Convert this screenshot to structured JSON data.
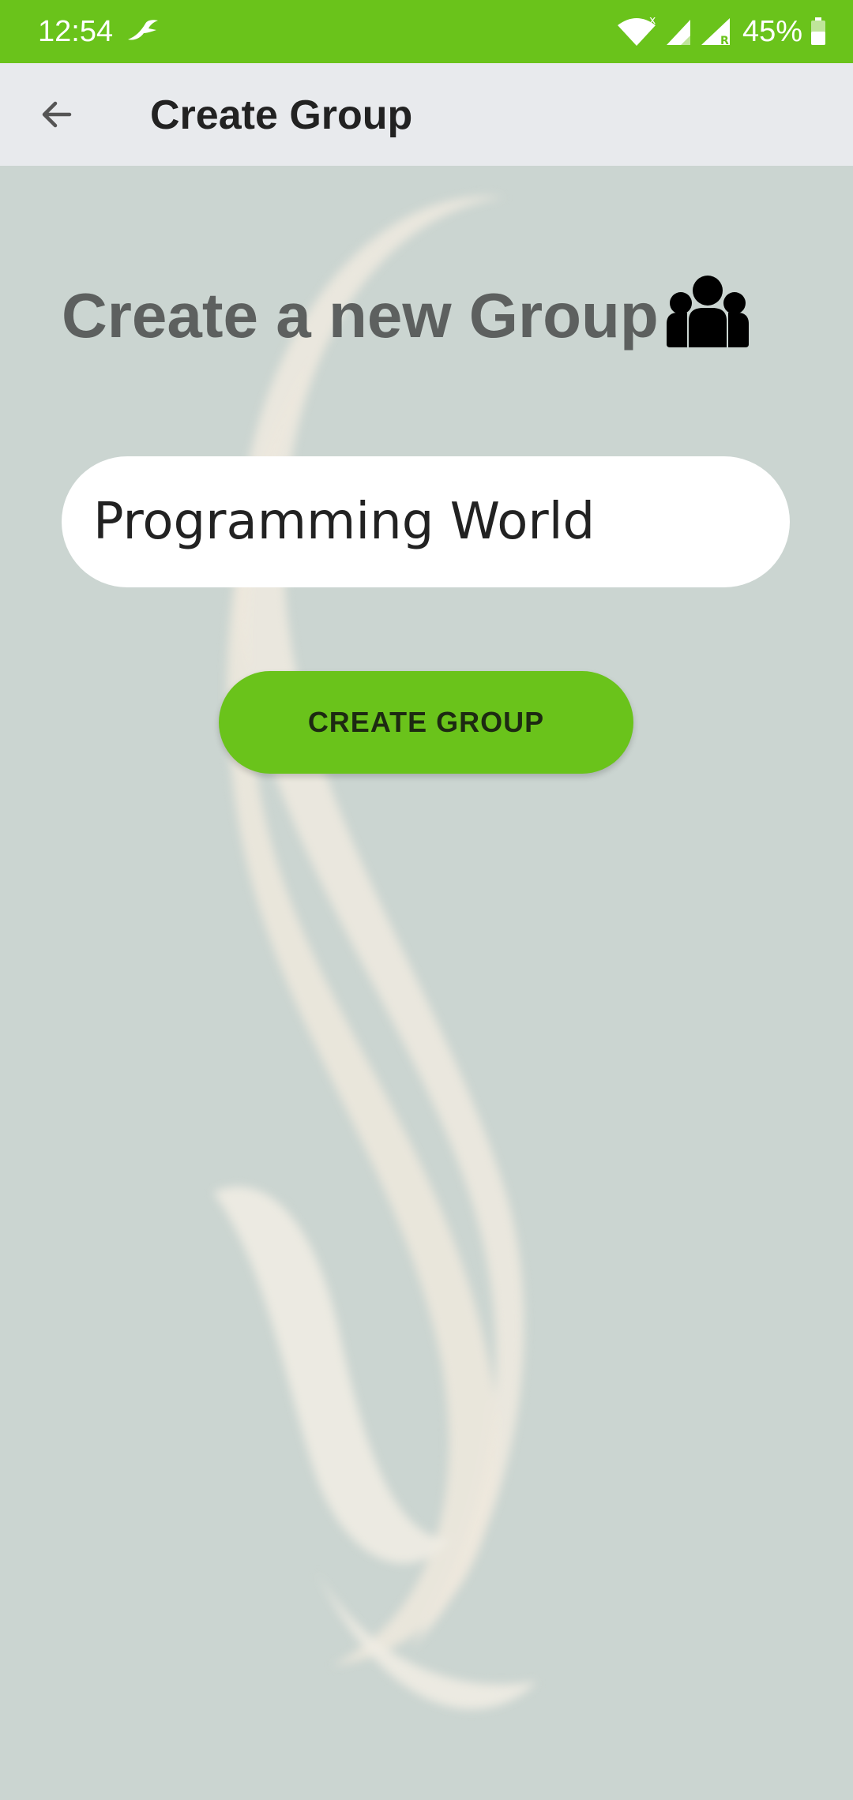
{
  "status_bar": {
    "time": "12:54",
    "battery": "45%",
    "icons": [
      "notification-bird-icon",
      "wifi-icon",
      "signal-icon",
      "roaming-signal-icon",
      "battery-icon"
    ]
  },
  "app_bar": {
    "title": "Create Group",
    "back_icon": "arrow-left-icon"
  },
  "main": {
    "headline": "Create a new Group",
    "headline_icon": "group-people-icon",
    "group_name_value": "Programming World",
    "create_button_label": "CREATE GROUP"
  },
  "colors": {
    "accent": "#6ac31b",
    "app_bar_bg": "#e8eaed",
    "background": "#cbd5d1",
    "headline_text": "#5d605f"
  }
}
